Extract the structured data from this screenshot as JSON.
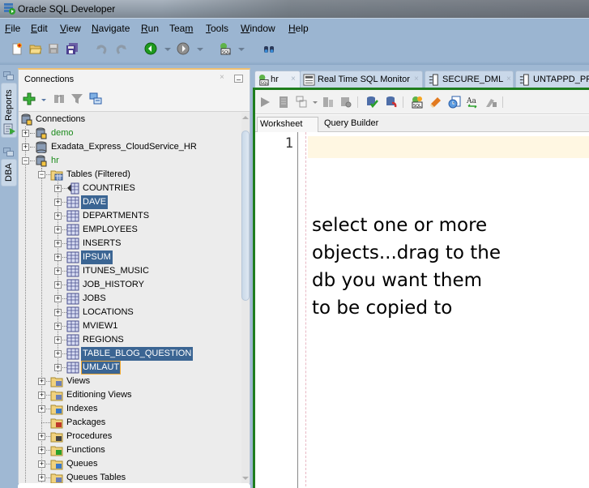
{
  "window": {
    "title": "Oracle SQL Developer"
  },
  "menu": [
    {
      "label": "File",
      "mnemonic": "F",
      "rest": "ile"
    },
    {
      "label": "Edit",
      "mnemonic": "E",
      "rest": "dit"
    },
    {
      "label": "View",
      "mnemonic": "V",
      "rest": "iew"
    },
    {
      "label": "Navigate",
      "mnemonic": "N",
      "rest": "avigate"
    },
    {
      "label": "Run",
      "mnemonic": "R",
      "rest": "un"
    },
    {
      "label": "Team",
      "pre": "Tea",
      "mnemonic": "m"
    },
    {
      "label": "Tools",
      "mnemonic": "T",
      "rest": "ools"
    },
    {
      "label": "Window",
      "mnemonic": "W",
      "rest": "indow"
    },
    {
      "label": "Help",
      "mnemonic": "H",
      "rest": "elp"
    }
  ],
  "toolbar": {
    "icons": [
      "new-file-icon",
      "open-folder-icon",
      "save-icon",
      "save-all-icon",
      "undo-icon",
      "redo-icon",
      "back-icon",
      "forward-icon",
      "sql-worksheet-icon",
      "find-binoculars-icon"
    ]
  },
  "left_dock": {
    "tabs": [
      {
        "label": "Reports"
      },
      {
        "label": "DBA"
      }
    ]
  },
  "connections_panel": {
    "title": "Connections",
    "close_glyph": "×",
    "tree": {
      "root": "Connections",
      "connections": [
        {
          "label": "demo",
          "expanded": false,
          "connected": true
        },
        {
          "label": "Exadata_Express_CloudService_HR",
          "expanded": false,
          "connected": false
        },
        {
          "label": "hr",
          "expanded": true,
          "connected": true
        }
      ],
      "tables_node": "Tables (Filtered)",
      "tables": [
        {
          "label": "COUNTRIES",
          "selected": false
        },
        {
          "label": "DAVE",
          "selected": true
        },
        {
          "label": "DEPARTMENTS",
          "selected": false
        },
        {
          "label": "EMPLOYEES",
          "selected": false
        },
        {
          "label": "INSERTS",
          "selected": false
        },
        {
          "label": "IPSUM",
          "selected": true
        },
        {
          "label": "ITUNES_MUSIC",
          "selected": false
        },
        {
          "label": "JOB_HISTORY",
          "selected": false
        },
        {
          "label": "JOBS",
          "selected": false
        },
        {
          "label": "LOCATIONS",
          "selected": false
        },
        {
          "label": "MVIEW1",
          "selected": false
        },
        {
          "label": "REGIONS",
          "selected": false
        },
        {
          "label": "TABLE_BLOG_QUESTION",
          "selected": true
        },
        {
          "label": "UMLAUT",
          "selected": true,
          "focused": true
        }
      ],
      "other_nodes": [
        {
          "label": "Views",
          "expandable": true
        },
        {
          "label": "Editioning Views",
          "expandable": true
        },
        {
          "label": "Indexes",
          "expandable": true
        },
        {
          "label": "Packages",
          "expandable": false
        },
        {
          "label": "Procedures",
          "expandable": true
        },
        {
          "label": "Functions",
          "expandable": true
        },
        {
          "label": "Queues",
          "expandable": true
        },
        {
          "label": "Queues Tables",
          "expandable": true
        }
      ]
    }
  },
  "editor": {
    "tabs": [
      {
        "label": "hr",
        "close": "×"
      },
      {
        "label": "Real Time SQL Monitor",
        "close": "×"
      },
      {
        "label": "SECURE_DML",
        "close": "×"
      },
      {
        "label": "UNTAPPD_PRC",
        "close": ""
      }
    ],
    "subtabs": [
      "Worksheet",
      "Query Builder"
    ],
    "line_number": "1",
    "annotation": "select one or more\nobjects...drag to the\ndb you want them\nto be copied to"
  },
  "colors": {
    "selection": "#3b6593",
    "connected_text": "#1a8a1a",
    "editor_frame": "#1e7d1e",
    "current_line": "#fff7e2"
  }
}
